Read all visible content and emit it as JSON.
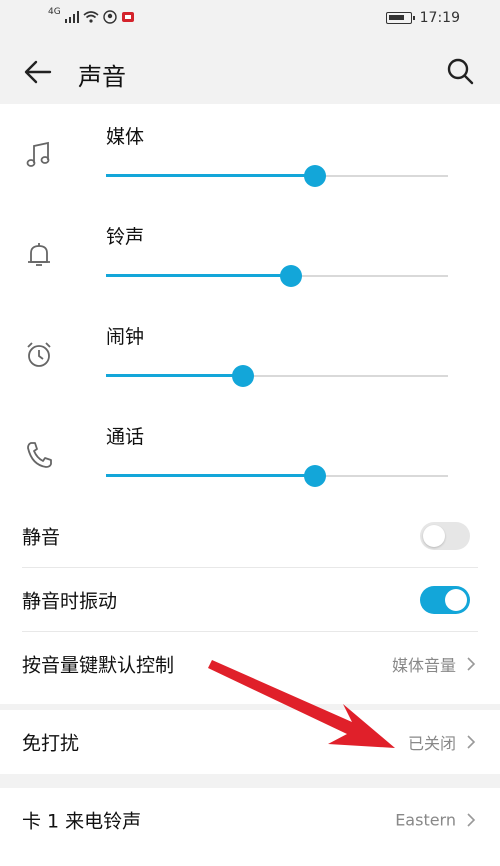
{
  "status_bar": {
    "network": "4G",
    "time": "17:19"
  },
  "header": {
    "title": "声音",
    "back_icon": "back-arrow-icon",
    "search_icon": "search-icon"
  },
  "volumes": [
    {
      "label": "媒体",
      "icon": "music-note-icon",
      "level": 0.61
    },
    {
      "label": "铃声",
      "icon": "bell-icon",
      "level": 0.54
    },
    {
      "label": "闹钟",
      "icon": "alarm-clock-icon",
      "level": 0.4
    },
    {
      "label": "通话",
      "icon": "phone-icon",
      "level": 0.61
    }
  ],
  "settings": {
    "mute": {
      "label": "静音",
      "enabled": false
    },
    "vibrate_on_mute": {
      "label": "静音时振动",
      "enabled": true
    },
    "volume_key_default": {
      "label": "按音量键默认控制",
      "value": "媒体音量"
    },
    "do_not_disturb": {
      "label": "免打扰",
      "value": "已关闭"
    },
    "sim1_ringtone": {
      "label": "卡 1 来电铃声",
      "value": "Eastern"
    }
  },
  "colors": {
    "accent": "#13a6d9",
    "annotation_arrow": "#e0202a",
    "background": "#f2f2f2"
  }
}
